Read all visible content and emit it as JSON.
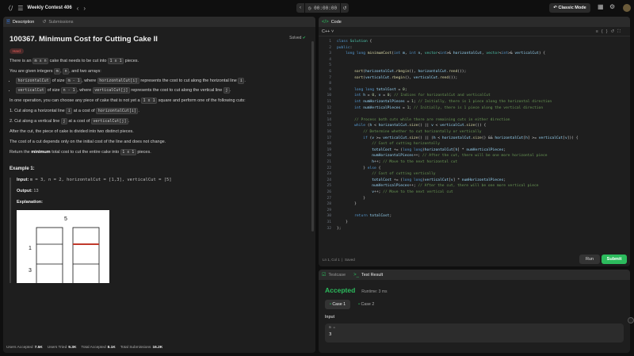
{
  "topbar": {
    "contest_title": "Weekly Contest 406",
    "timer": "00:00:00",
    "classic_mode_label": "Classic Mode"
  },
  "left_panel": {
    "tabs": [
      {
        "label": "Description",
        "active": true
      },
      {
        "label": "Submissions",
        "active": false
      }
    ],
    "title": "100367. Minimum Cost for Cutting Cake II",
    "solved_label": "Solved",
    "difficulty": "Hard",
    "para1_a": "There is an ",
    "para1_code1": "m x n",
    "para1_b": " cake that needs to be cut into ",
    "para1_code2": "1 x 1",
    "para1_c": " pieces.",
    "para2_a": "You are given integers ",
    "para2_code1": "m",
    "para2_b": ", ",
    "para2_code2": "n",
    "para2_c": ", and two arrays:",
    "bullet1_code1": "horizontalCut",
    "bullet1_a": " of size ",
    "bullet1_code2": "m - 1",
    "bullet1_b": ", where ",
    "bullet1_code3": "horizontalCut[i]",
    "bullet1_c": " represents the cost to cut along the horizontal line ",
    "bullet1_code4": "i",
    "bullet1_d": ".",
    "bullet2_code1": "verticalCut",
    "bullet2_a": " of size ",
    "bullet2_code2": "n - 1",
    "bullet2_b": ", where ",
    "bullet2_code3": "verticalCut[j]",
    "bullet2_c": " represents the cost to cut along the vertical line ",
    "bullet2_code4": "j",
    "bullet2_d": ".",
    "para3_a": "In one operation, you can choose any piece of cake that is not yet a ",
    "para3_code": "1 x 1",
    "para3_b": " square and perform one of the following cuts:",
    "op1_a": "1. Cut along a horizontal line ",
    "op1_code1": "i",
    "op1_b": " at a cost of ",
    "op1_code2": "horizontalCut[i]",
    "op1_c": ".",
    "op2_a": "2. Cut along a vertical line ",
    "op2_code1": "j",
    "op2_b": " at a cost of ",
    "op2_code2": "verticalCut[j]",
    "op2_c": ".",
    "para4": "After the cut, the piece of cake is divided into two distinct pieces.",
    "para5": "The cost of a cut depends only on the initial cost of the line and does not change.",
    "para6_a": "Return the ",
    "para6_bold": "minimum",
    "para6_b": " total cost to cut the entire cake into ",
    "para6_code": "1 x 1",
    "para6_c": " pieces.",
    "example_title": "Example 1:",
    "input_label": "Input:",
    "input_value": "m = 3, n = 2, horizontalCut = [1,3], verticalCut = [5]",
    "output_label": "Output:",
    "output_value": "13",
    "explanation_label": "Explanation:",
    "diagram_labels": {
      "top": "5",
      "left1": "1",
      "left2": "3"
    },
    "stats": [
      {
        "label": "Users Accepted",
        "value": "7.5K"
      },
      {
        "label": "Users Tried",
        "value": "9.3K"
      },
      {
        "label": "Total Accepted",
        "value": "8.1K"
      },
      {
        "label": "Total Submissions",
        "value": "16.2K"
      }
    ]
  },
  "code_panel": {
    "tab_label": "Code",
    "language": "C++",
    "cursor_status": "Ln 1, Col 1",
    "saved_label": "Saved",
    "run_label": "Run",
    "submit_label": "Submit"
  },
  "result_panel": {
    "tabs": [
      {
        "label": "Testcase",
        "active": false
      },
      {
        "label": "Test Result",
        "active": true
      }
    ],
    "status": "Accepted",
    "runtime": "Runtime: 3 ms",
    "cases": [
      "Case 1",
      "Case 2"
    ],
    "input_label": "Input",
    "input_var": "m =",
    "input_val": "3"
  },
  "colors": {
    "accent_green": "#2cbb5d",
    "hard_red": "#f8615c",
    "cut_red": "#c0392b"
  }
}
